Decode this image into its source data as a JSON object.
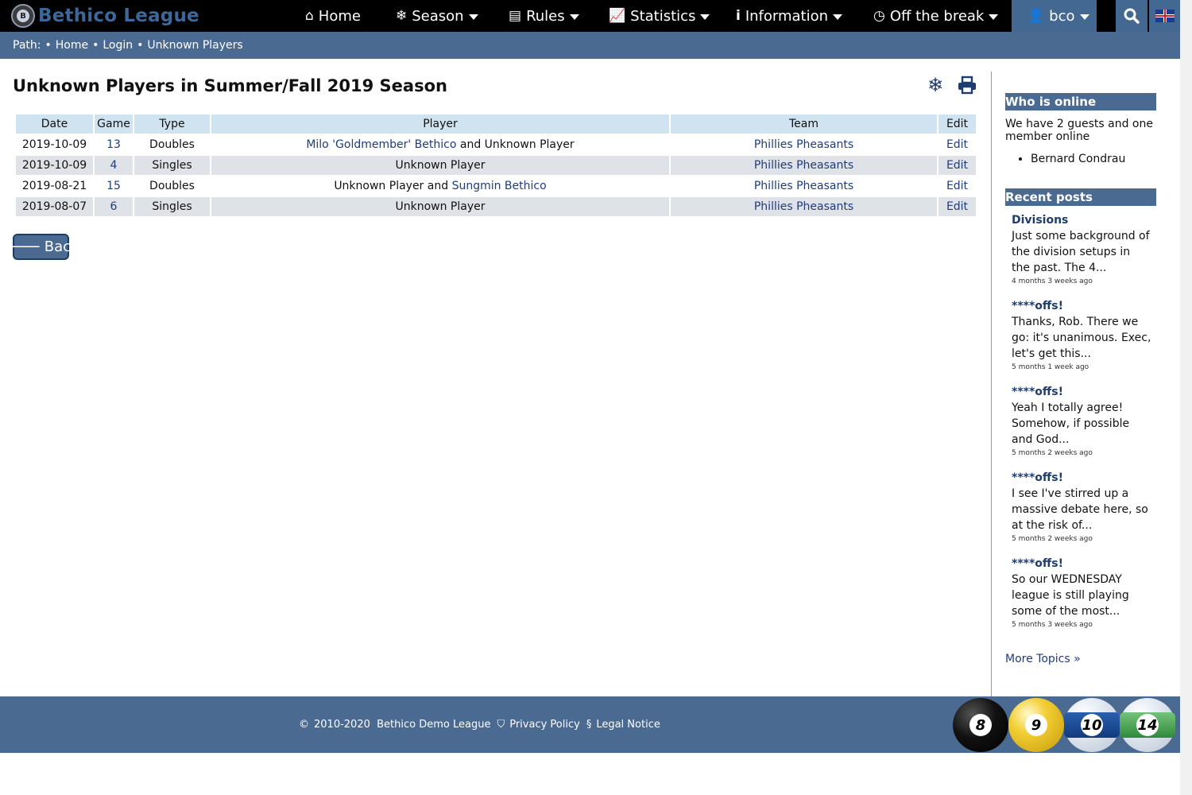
{
  "brand": {
    "name": "Bethico League",
    "ball_letter": "B"
  },
  "nav": {
    "home": "Home",
    "season": "Season",
    "rules": "Rules",
    "statistics": "Statistics",
    "information": "Information",
    "off_the_break": "Off the break",
    "user": "bco"
  },
  "breadcrumb": {
    "label": "Path:",
    "sep": "•",
    "items": [
      "Home",
      "Login",
      "Unknown Players"
    ]
  },
  "page": {
    "title": "Unknown Players in Summer/Fall 2019 Season",
    "back_label": "Back"
  },
  "table": {
    "headers": [
      "Date",
      "Game",
      "Type",
      "Player",
      "Team",
      "Edit"
    ],
    "rows": [
      {
        "date": "2019-10-09",
        "game": "13",
        "type": "Doubles",
        "player_link": "Milo 'Goldmember' Bethico",
        "player_rest": " and Unknown Player",
        "team": "Phillies Pheasants",
        "edit": "Edit"
      },
      {
        "date": "2019-10-09",
        "game": "4",
        "type": "Singles",
        "player_text": "Unknown Player",
        "team": "Phillies Pheasants",
        "edit": "Edit"
      },
      {
        "date": "2019-08-21",
        "game": "15",
        "type": "Doubles",
        "player_pre": "Unknown Player and ",
        "player_link": "Sungmin Bethico",
        "team": "Phillies Pheasants",
        "edit": "Edit"
      },
      {
        "date": "2019-08-07",
        "game": "6",
        "type": "Singles",
        "player_text": "Unknown Player",
        "team": "Phillies Pheasants",
        "edit": "Edit"
      }
    ]
  },
  "sidebar": {
    "online_title": "Who is online",
    "online_text": "We have 2 guests and one member online",
    "online_members": [
      "Bernard Condrau"
    ],
    "recent_title": "Recent posts",
    "posts": [
      {
        "title": "Divisions",
        "text": "Just some background of the division setups in the past. The 4...",
        "time": "4 months 3 weeks ago"
      },
      {
        "title": "****offs!",
        "text": "Thanks, Rob. There we go: it's unanimous. Exec, let's get this...",
        "time": "5 months 1 week ago"
      },
      {
        "title": "****offs!",
        "text": "Yeah I totally agree! Somehow, if possible and God...",
        "time": "5 months 2 weeks ago"
      },
      {
        "title": "****offs!",
        "text": "I see I've stirred up a massive debate here, so at the risk of...",
        "time": "5 months 2 weeks ago"
      },
      {
        "title": "****offs!",
        "text": "So our WEDNESDAY league is still playing some of the most...",
        "time": "5 months 3 weeks ago"
      }
    ],
    "more_topics": "More Topics »"
  },
  "footer": {
    "copyright_symbol": "©",
    "copyright": "2010-2020  Bethico Demo League",
    "privacy_symbol": "⛉",
    "privacy": "Privacy Policy",
    "legal_symbol": "§",
    "legal": "Legal Notice",
    "balls": [
      "8",
      "9",
      "10",
      "14"
    ]
  },
  "colors": {
    "nav_bg": "#000000",
    "accent": "#4a6a92",
    "table_header": "#cfe3f1",
    "row_alt": "#dfe2e6",
    "link": "#1f3c7a"
  }
}
